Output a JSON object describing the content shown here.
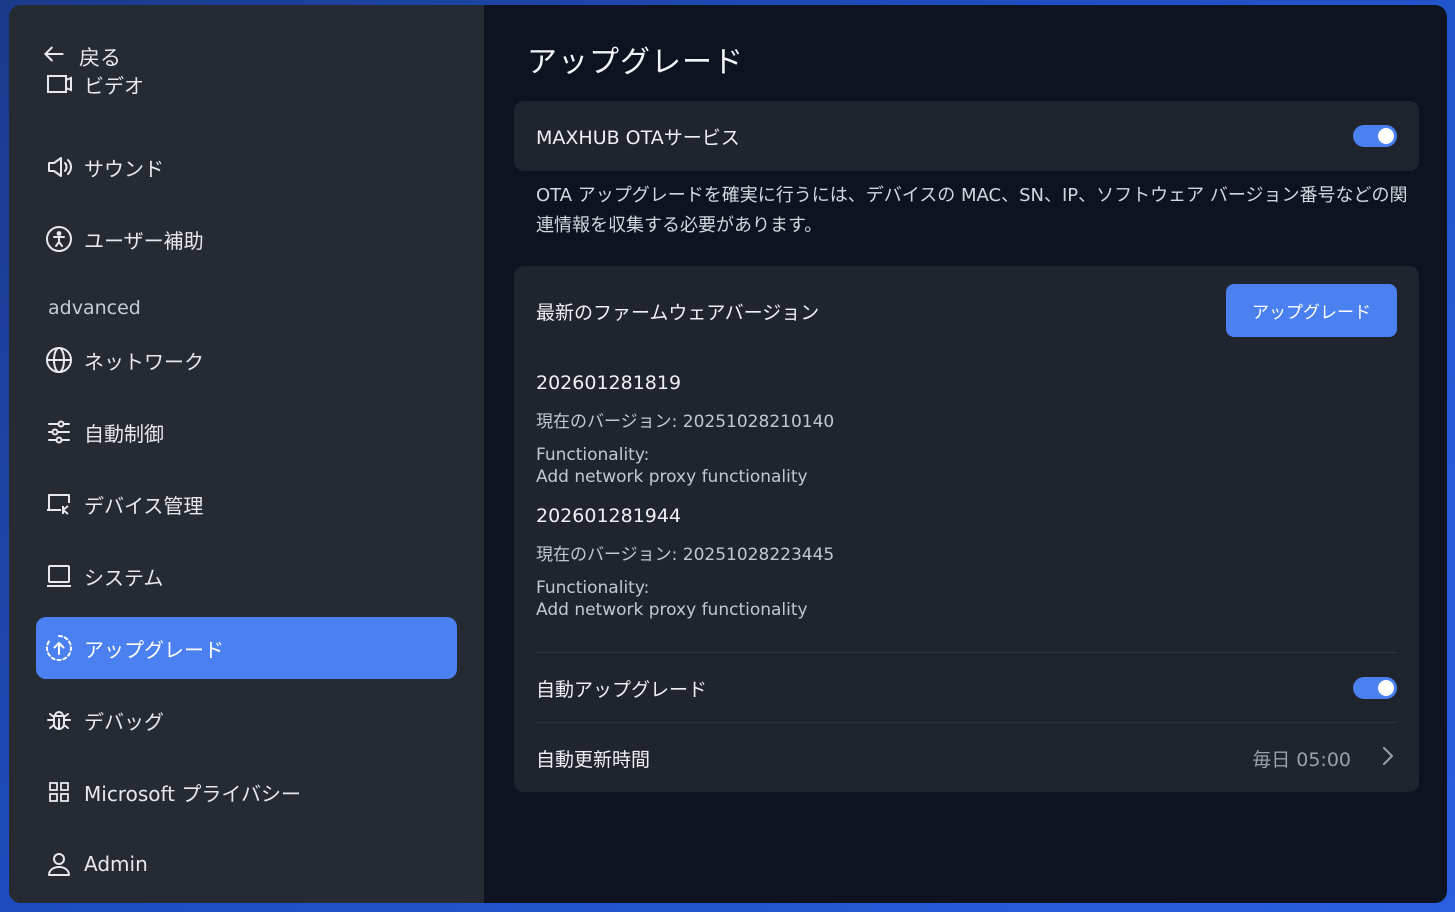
{
  "sidebar": {
    "back_label": "戻る",
    "section_advanced": "advanced",
    "items": [
      {
        "label": "ビデオ",
        "icon": "video-icon"
      },
      {
        "label": "サウンド",
        "icon": "speaker-icon"
      },
      {
        "label": "ユーザー補助",
        "icon": "accessibility-icon"
      },
      {
        "label": "ネットワーク",
        "icon": "globe-icon"
      },
      {
        "label": "自動制御",
        "icon": "sliders-icon"
      },
      {
        "label": "デバイス管理",
        "icon": "device-management-icon"
      },
      {
        "label": "システム",
        "icon": "monitor-icon"
      },
      {
        "label": "アップグレード",
        "icon": "upgrade-icon",
        "active": true
      },
      {
        "label": "デバッグ",
        "icon": "bug-icon"
      },
      {
        "label": "Microsoft プライバシー",
        "icon": "grid-icon"
      },
      {
        "label": "Admin",
        "icon": "user-icon"
      }
    ]
  },
  "main": {
    "title": "アップグレード",
    "ota": {
      "label": "MAXHUB OTAサービス",
      "enabled": true,
      "notice": "OTA アップグレードを確実に行うには、デバイスの MAC、SN、IP、ソフトウェア バージョン番号などの関連情報を収集する必要があります。"
    },
    "firmware": {
      "heading": "最新のファームウェアバージョン",
      "upgrade_button": "アップグレード",
      "versions": [
        {
          "version": "202601281819",
          "current": "現在のバージョン: 20251028210140",
          "functionality_label": "Functionality:",
          "functionality": "Add network proxy functionality"
        },
        {
          "version": "202601281944",
          "current": "現在のバージョン: 20251028223445",
          "functionality_label": "Functionality:",
          "functionality": "Add network proxy functionality"
        }
      ],
      "auto_upgrade": {
        "label": "自動アップグレード",
        "enabled": true
      },
      "auto_update_time": {
        "label": "自動更新時間",
        "value": "毎日 05:00"
      }
    }
  },
  "colors": {
    "accent": "#4a80ef",
    "sidebar_bg": "#262a33",
    "main_bg": "#0d1320",
    "card_bg": "#1f242e"
  }
}
